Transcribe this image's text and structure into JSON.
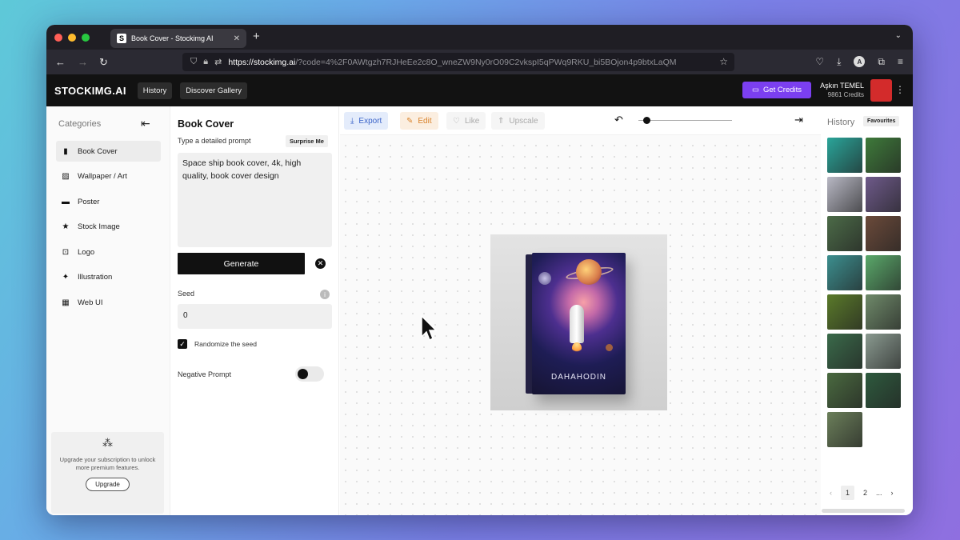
{
  "browser": {
    "tab_title": "Book Cover - Stockimg AI",
    "tab_favicon": "S",
    "url_host": "https://stockimg.ai",
    "url_rest": "/?code=4%2F0AWtgzh7RJHeEe2c8O_wneZW9Ny0rO09C2vkspI5qPWq9RKU_bi5BOjon4p9btxLaQM",
    "colors": {
      "close": "#ff5f57",
      "minimize": "#febc2e",
      "maximize": "#28c840"
    }
  },
  "header": {
    "logo": "STOCKIMG.AI",
    "nav": [
      "History",
      "Discover Gallery"
    ],
    "get_credits": "Get Credits",
    "user_name": "Aşkın TEMEL",
    "user_credits": "9861 Credits",
    "accent": "#7b3ff0"
  },
  "categories": {
    "title": "Categories",
    "items": [
      {
        "label": "Book Cover",
        "icon": "book-icon",
        "active": true
      },
      {
        "label": "Wallpaper / Art",
        "icon": "image-icon"
      },
      {
        "label": "Poster",
        "icon": "poster-icon"
      },
      {
        "label": "Stock Image",
        "icon": "star-icon"
      },
      {
        "label": "Logo",
        "icon": "logo-icon"
      },
      {
        "label": "Illustration",
        "icon": "sparkle-icon"
      },
      {
        "label": "Web UI",
        "icon": "grid-icon"
      }
    ],
    "upgrade_text": "Upgrade your subscription to unlock more premium features.",
    "upgrade_button": "Upgrade"
  },
  "form": {
    "title": "Book Cover",
    "prompt_label": "Type a detailed prompt",
    "surprise": "Surprise Me",
    "prompt_value": "Space ship book cover, 4k, high quality, book cover design",
    "generate": "Generate",
    "seed_label": "Seed",
    "seed_value": "0",
    "randomize_label": "Randomize the seed",
    "randomize_checked": true,
    "negative_label": "Negative Prompt",
    "negative_enabled": false
  },
  "toolbar": {
    "export": "Export",
    "edit": "Edit",
    "like": "Like",
    "upscale": "Upscale",
    "zoom_level": 0.05
  },
  "canvas": {
    "book_title": "DAHAHODIN"
  },
  "history": {
    "title": "History",
    "favourites": "Favourites",
    "thumbs": [
      "#2aa59a",
      "#3e7a3a",
      "#b8b8c4",
      "#6e5a8a",
      "#4c6b48",
      "#6b4a3a",
      "#3c8f8f",
      "#5aa86a",
      "#5a7a2a",
      "#6f8a6a",
      "#3a6a4a",
      "#8a9a90",
      "#4a6a40",
      "#2e5a3e",
      "#6b7f5a"
    ],
    "pages": [
      "1",
      "2",
      "..."
    ]
  }
}
